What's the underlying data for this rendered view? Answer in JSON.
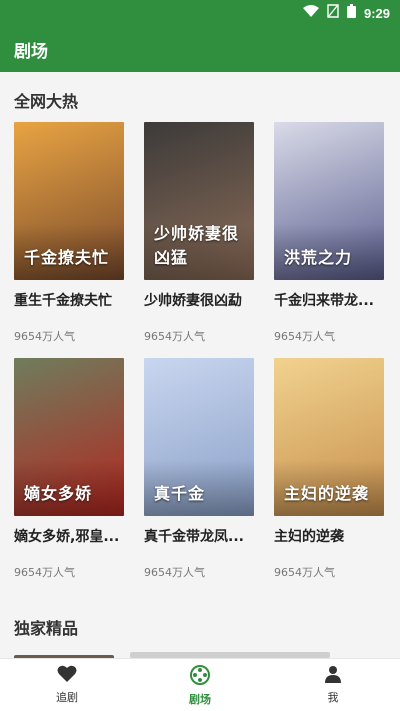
{
  "status": {
    "time": "9:29"
  },
  "appbar": {
    "title": "剧场"
  },
  "sections": {
    "hot": "全网大热",
    "exclusive": "独家精品"
  },
  "dramas": [
    {
      "title": "重生千金撩夫忙",
      "popularity": "9654万人气",
      "poster_text": "千金撩夫忙",
      "colors": [
        "#e8a443",
        "#7a4a2c"
      ]
    },
    {
      "title": "少帅娇妻很凶勐",
      "popularity": "9654万人气",
      "poster_text": "少帅娇妻很凶猛",
      "colors": [
        "#3c3a39",
        "#8c6d58"
      ]
    },
    {
      "title": "千金归来带龙...",
      "popularity": "9654万人气",
      "poster_text": "洪荒之力",
      "colors": [
        "#d9dbe8",
        "#5a5d8e"
      ]
    },
    {
      "title": "嫡女多娇,邪皇...",
      "popularity": "9654万人气",
      "poster_text": "嫡女多娇",
      "colors": [
        "#6f7d5d",
        "#b3261f"
      ]
    },
    {
      "title": "真千金带龙凤...",
      "popularity": "9654万人气",
      "poster_text": "真千金",
      "colors": [
        "#c9d6ef",
        "#8aa0c8"
      ]
    },
    {
      "title": "主妇的逆袭",
      "popularity": "9654万人气",
      "poster_text": "主妇的逆袭",
      "colors": [
        "#f1d28f",
        "#c78f4d"
      ]
    }
  ],
  "nav": [
    {
      "label": "追剧",
      "icon": "heart-icon",
      "active": false
    },
    {
      "label": "剧场",
      "icon": "film-reel-icon",
      "active": true
    },
    {
      "label": "我",
      "icon": "person-icon",
      "active": false
    }
  ]
}
